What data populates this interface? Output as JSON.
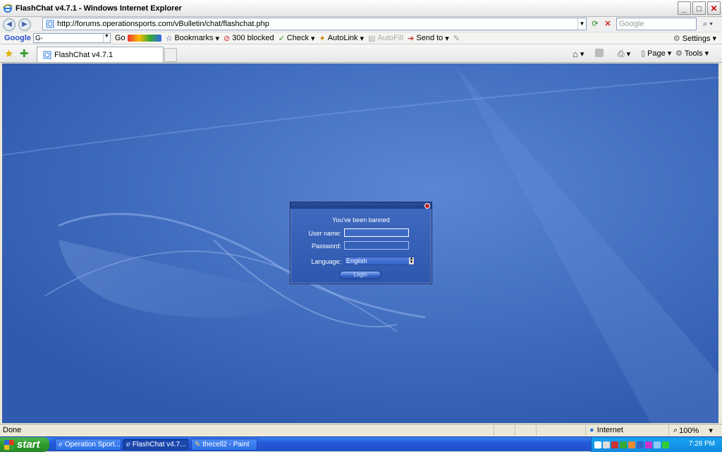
{
  "window": {
    "title": "FlashChat v4.7.1 - Windows Internet Explorer"
  },
  "address": {
    "url": "http://forums.operationsports.com/vBulletin/chat/flashchat.php",
    "search_placeholder": "Google"
  },
  "google_toolbar": {
    "logo": "Google",
    "search_value": "G-",
    "go_label": "Go",
    "bookmarks": "Bookmarks",
    "blocked": "300 blocked",
    "check": "Check",
    "autolink": "AutoLink",
    "autofill": "AutoFill",
    "sendto": "Send to",
    "settings": "Settings"
  },
  "tabs": [
    {
      "label": "FlashChat v4.7.1"
    }
  ],
  "command_bar": {
    "page": "Page",
    "tools": "Tools"
  },
  "dialog": {
    "message": "You've been banned",
    "username_label": "User name:",
    "password_label": "Password:",
    "language_label": "Language:",
    "language_value": "English",
    "login_label": "Login"
  },
  "status": {
    "text": "Done",
    "zone": "Internet",
    "zoom": "100%"
  },
  "taskbar": {
    "start": "start",
    "tasks": [
      {
        "label": "Operation Sport..."
      },
      {
        "label": "FlashChat v4.7..."
      },
      {
        "label": "thecell2 - Paint"
      }
    ],
    "clock": "7:28 PM"
  }
}
